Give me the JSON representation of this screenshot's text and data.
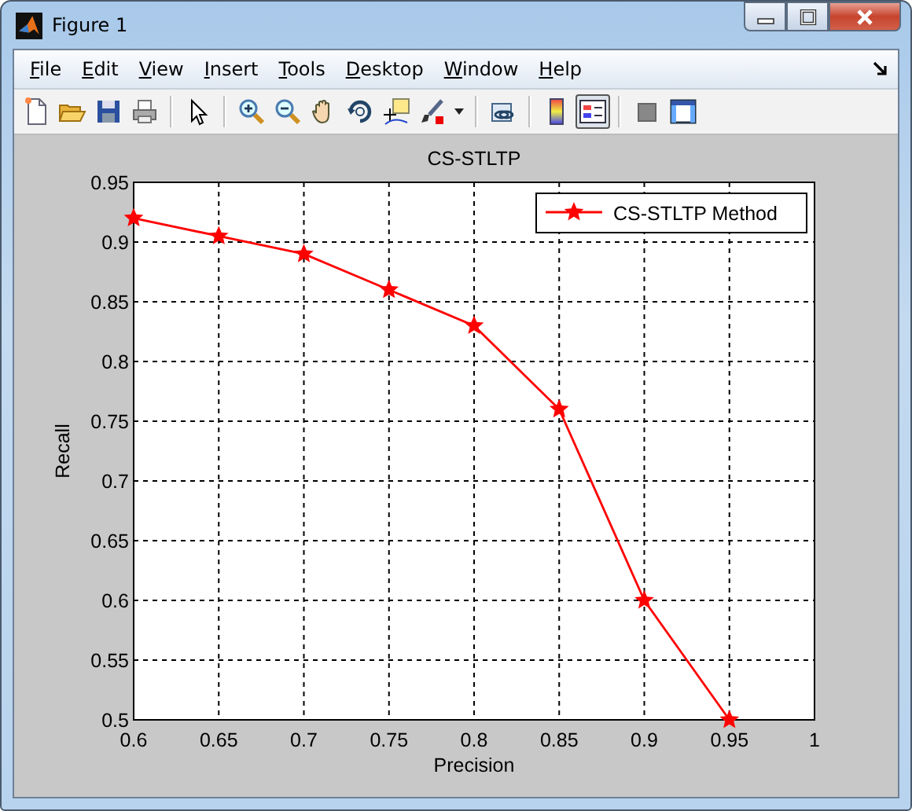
{
  "window": {
    "title": "Figure 1"
  },
  "menu": [
    {
      "label": "File"
    },
    {
      "label": "Edit"
    },
    {
      "label": "View"
    },
    {
      "label": "Insert"
    },
    {
      "label": "Tools"
    },
    {
      "label": "Desktop"
    },
    {
      "label": "Window"
    },
    {
      "label": "Help"
    }
  ],
  "toolbar": [
    {
      "kind": "new",
      "selected": false
    },
    {
      "kind": "open",
      "selected": false
    },
    {
      "kind": "save",
      "selected": false
    },
    {
      "kind": "print",
      "selected": false
    },
    {
      "kind": "separator"
    },
    {
      "kind": "pointer",
      "selected": false
    },
    {
      "kind": "separator"
    },
    {
      "kind": "zoom-in",
      "selected": false
    },
    {
      "kind": "zoom-out",
      "selected": false
    },
    {
      "kind": "pan",
      "selected": false
    },
    {
      "kind": "rotate",
      "selected": false
    },
    {
      "kind": "data-cursor",
      "selected": false
    },
    {
      "kind": "brush",
      "selected": false
    },
    {
      "kind": "dropdown",
      "selected": false
    },
    {
      "kind": "separator"
    },
    {
      "kind": "link",
      "selected": false
    },
    {
      "kind": "separator"
    },
    {
      "kind": "colorbar",
      "selected": false
    },
    {
      "kind": "legend",
      "selected": true
    },
    {
      "kind": "separator"
    },
    {
      "kind": "hide-tools",
      "selected": false
    },
    {
      "kind": "show-tools",
      "selected": false
    }
  ],
  "figure": {
    "chart_data": {
      "type": "line",
      "title": "CS-STLTP",
      "xlabel": "Precision",
      "ylabel": "Recall",
      "x": [
        0.6,
        0.65,
        0.7,
        0.75,
        0.8,
        0.85,
        0.9,
        0.95
      ],
      "grid": true,
      "series": [
        {
          "name": "CS-STLTP Method",
          "color": "#ff0000",
          "marker": "star",
          "values": [
            0.92,
            0.905,
            0.89,
            0.86,
            0.83,
            0.76,
            0.6,
            0.5
          ]
        }
      ],
      "xlim": [
        0.6,
        1
      ],
      "ylim": [
        0.5,
        0.95
      ],
      "xticks": [
        0.6,
        0.65,
        0.7,
        0.75,
        0.8,
        0.85,
        0.9,
        0.95,
        1
      ],
      "yticks": [
        0.5,
        0.55,
        0.6,
        0.65,
        0.7,
        0.75,
        0.8,
        0.85,
        0.9,
        0.95
      ]
    }
  }
}
